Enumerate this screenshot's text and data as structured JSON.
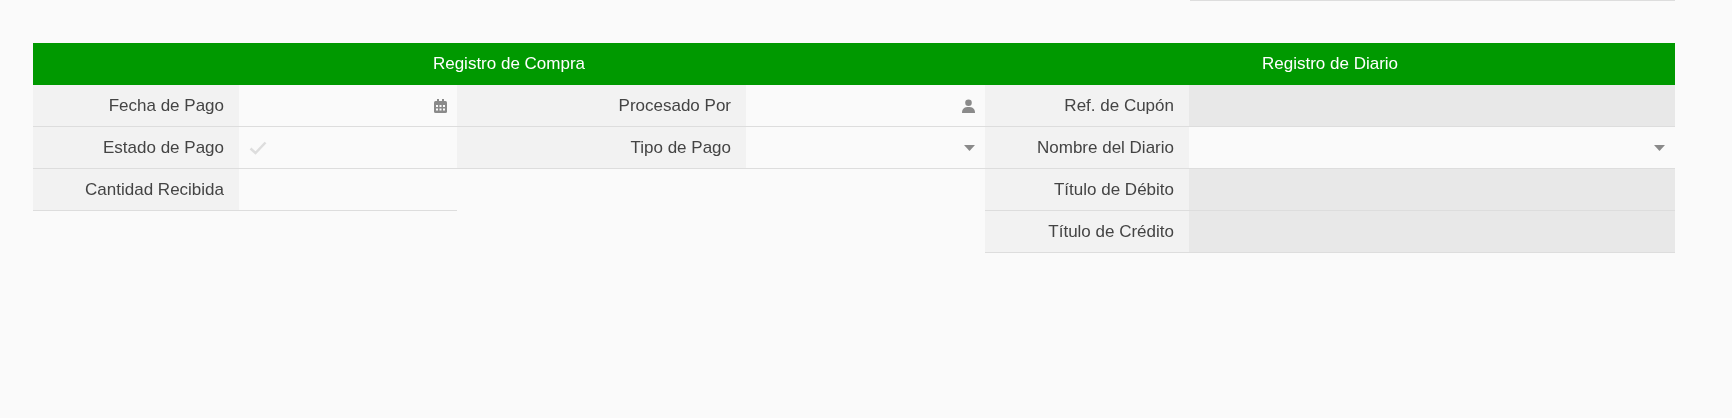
{
  "sections": [
    {
      "title": "Registro de Compra",
      "columns": [
        [
          {
            "label": "Fecha de Pago",
            "kind": "date"
          },
          {
            "label": "Estado de Pago",
            "kind": "checkbox",
            "checked": false
          },
          {
            "label": "Cantidad Recibida",
            "kind": "text"
          }
        ],
        [
          {
            "label": "Procesado Por",
            "kind": "user"
          },
          {
            "label": "Tipo de Pago",
            "kind": "select"
          }
        ]
      ]
    },
    {
      "title": "Registro de Diario",
      "columns": [
        [
          {
            "label": "Ref. de Cupón",
            "kind": "readonly"
          },
          {
            "label": "Nombre del Diario",
            "kind": "select"
          },
          {
            "label": "Título de Débito",
            "kind": "readonly"
          },
          {
            "label": "Título de Crédito",
            "kind": "readonly"
          }
        ]
      ]
    }
  ]
}
